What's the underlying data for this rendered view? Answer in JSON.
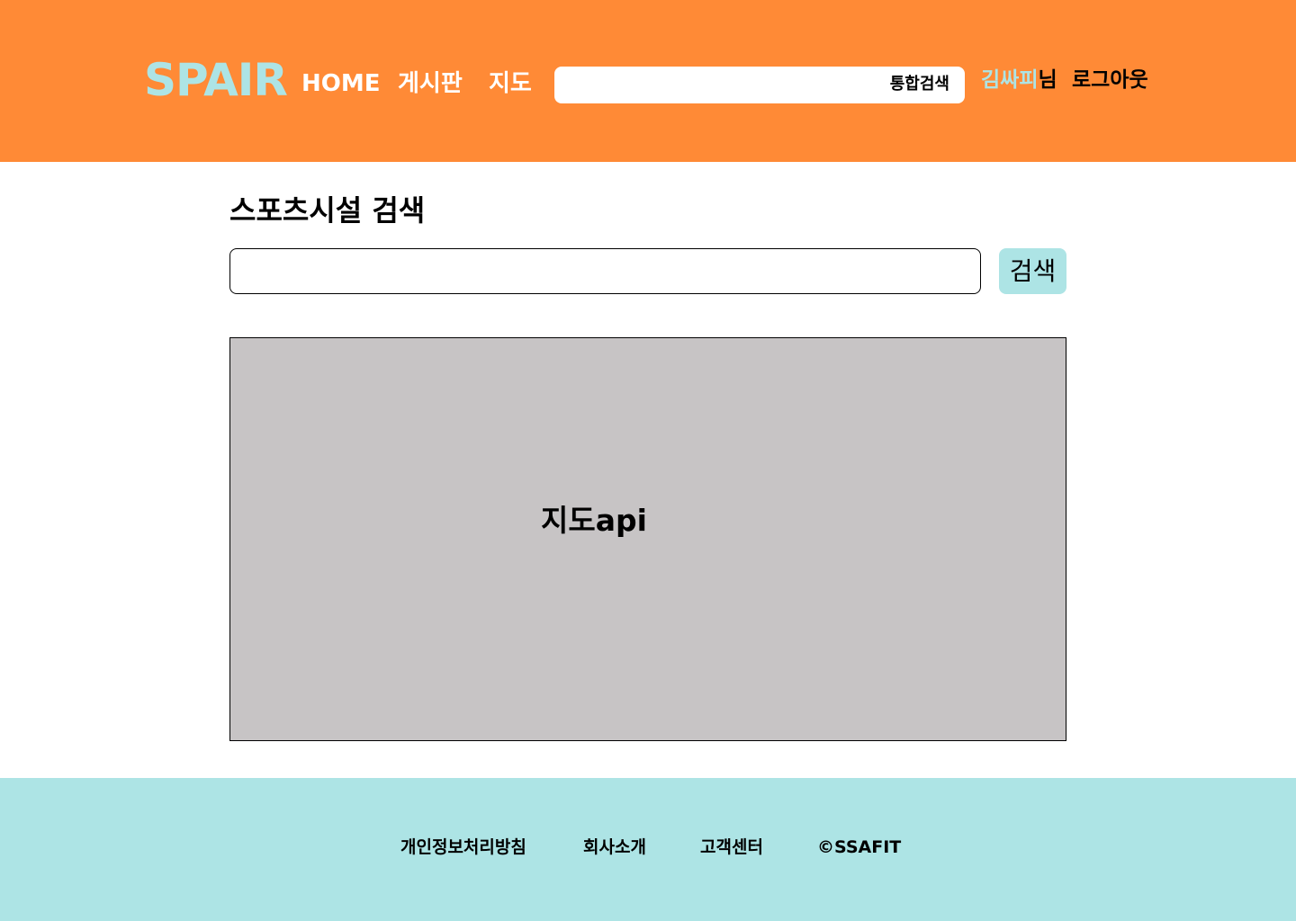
{
  "header": {
    "logo": "SPAIR",
    "nav": {
      "home": "HOME",
      "board": "게시판",
      "map": "지도"
    },
    "search": {
      "value": "",
      "placeholder": "",
      "label": "통합검색"
    },
    "user": {
      "name": "김싸피",
      "suffix": "님"
    },
    "logout": "로그아웃"
  },
  "main": {
    "title": "스포츠시설 검색",
    "search_input": {
      "value": "",
      "placeholder": ""
    },
    "search_button": "검색",
    "map_placeholder": "지도api"
  },
  "footer": {
    "links": [
      "개인정보처리방침",
      "회사소개",
      "고객센터"
    ],
    "copyright": "©SSAFIT"
  },
  "colors": {
    "header_bg": "#FF8A36",
    "accent": "#ADE4E5",
    "map_bg": "#C7C4C5",
    "footer_bg": "#ADE4E5"
  }
}
